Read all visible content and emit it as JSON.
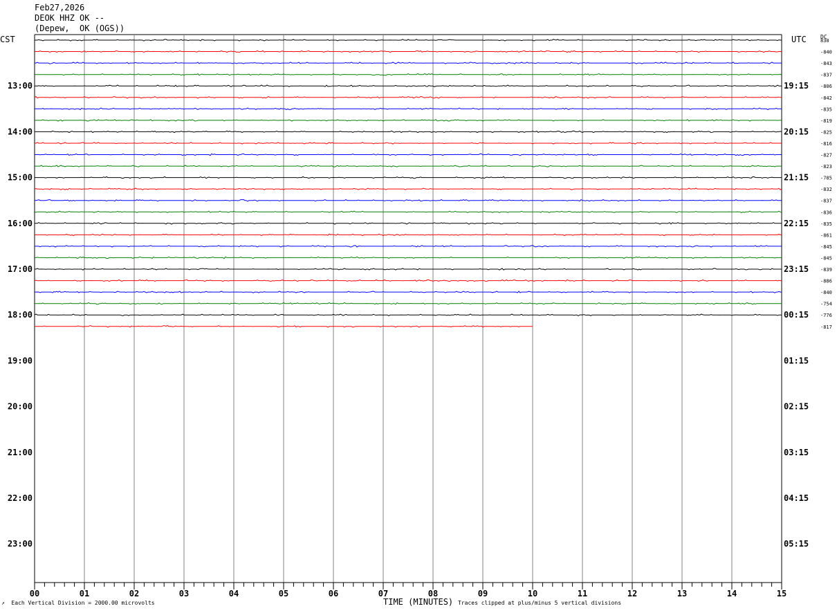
{
  "header": {
    "date": "Feb27,2026",
    "station": "DEOK HHZ OK --",
    "location": "(Depew,  OK (OGS))"
  },
  "labels": {
    "left_zone": "CST",
    "right_zone": "UTC",
    "dc": "DC"
  },
  "footer": {
    "scale_note": "Each Vertical Division = 2000.00 microvolts",
    "clip_note": "Traces clipped at plus/minus 5 vertical divisions",
    "corner_mark": "↗"
  },
  "colors": {
    "trace_cycle": [
      "#000000",
      "#ff0000",
      "#0000ff",
      "#008000"
    ],
    "grid": "#808080"
  },
  "chart_data": {
    "type": "line",
    "title": "DEOK HHZ OK --",
    "xlabel": "TIME (MINUTES)",
    "xlim": [
      0,
      15
    ],
    "x_ticks": [
      "00",
      "01",
      "02",
      "03",
      "04",
      "05",
      "06",
      "07",
      "08",
      "09",
      "10",
      "11",
      "12",
      "13",
      "14",
      "15"
    ],
    "hours_left": [
      "13:00",
      "14:00",
      "15:00",
      "16:00",
      "17:00",
      "18:00",
      "19:00",
      "20:00",
      "21:00",
      "22:00",
      "23:00"
    ],
    "hours_right": [
      "19:15",
      "20:15",
      "21:15",
      "22:15",
      "23:15",
      "00:15",
      "01:15",
      "02:15",
      "03:15",
      "04:15",
      "05:15"
    ],
    "trace_count": 26,
    "last_trace_end_minute": 10,
    "dc_offsets": [
      "830",
      "-840",
      "-843",
      "-837",
      "-806",
      "-842",
      "-835",
      "-819",
      "-825",
      "-816",
      "-827",
      "-823",
      "-785",
      "-832",
      "-837",
      "-836",
      "-835",
      "-861",
      "-845",
      "-845",
      "-839",
      "-886",
      "-840",
      "-754",
      "-776",
      "-817"
    ]
  }
}
